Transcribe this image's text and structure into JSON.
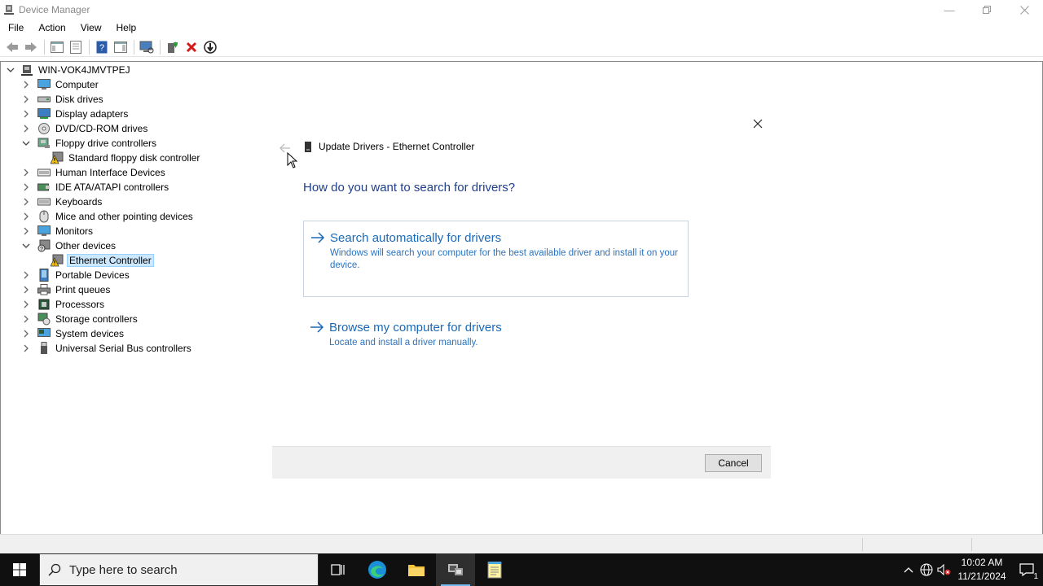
{
  "window": {
    "title": "Device Manager"
  },
  "menu": {
    "file": "File",
    "action": "Action",
    "view": "View",
    "help": "Help"
  },
  "tree": {
    "root": "WIN-VOK4JMVTPEJ",
    "items": [
      {
        "label": "Computer",
        "icon": "computer-icon",
        "expanded": false
      },
      {
        "label": "Disk drives",
        "icon": "disk-drive-icon",
        "expanded": false
      },
      {
        "label": "Display adapters",
        "icon": "display-adapter-icon",
        "expanded": false
      },
      {
        "label": "DVD/CD-ROM drives",
        "icon": "dvd-drive-icon",
        "expanded": false
      },
      {
        "label": "Floppy drive controllers",
        "icon": "floppy-controller-icon",
        "expanded": true
      },
      {
        "label": "Standard floppy disk controller",
        "icon": "warning-device-icon",
        "child": true
      },
      {
        "label": "Human Interface Devices",
        "icon": "hid-icon",
        "expanded": false
      },
      {
        "label": "IDE ATA/ATAPI controllers",
        "icon": "ide-controller-icon",
        "expanded": false
      },
      {
        "label": "Keyboards",
        "icon": "keyboard-icon",
        "expanded": false
      },
      {
        "label": "Mice and other pointing devices",
        "icon": "mouse-icon",
        "expanded": false
      },
      {
        "label": "Monitors",
        "icon": "monitor-icon",
        "expanded": false
      },
      {
        "label": "Other devices",
        "icon": "other-devices-icon",
        "expanded": true
      },
      {
        "label": "Ethernet Controller",
        "icon": "warning-device-icon",
        "child": true,
        "selected": true
      },
      {
        "label": "Portable Devices",
        "icon": "portable-device-icon",
        "expanded": false
      },
      {
        "label": "Print queues",
        "icon": "printer-icon",
        "expanded": false
      },
      {
        "label": "Processors",
        "icon": "processor-icon",
        "expanded": false
      },
      {
        "label": "Storage controllers",
        "icon": "storage-controller-icon",
        "expanded": false
      },
      {
        "label": "System devices",
        "icon": "system-devices-icon",
        "expanded": false
      },
      {
        "label": "Universal Serial Bus controllers",
        "icon": "usb-icon",
        "expanded": false
      }
    ]
  },
  "dialog": {
    "title": "Update Drivers - Ethernet Controller",
    "heading": "How do you want to search for drivers?",
    "option_auto": {
      "title": "Search automatically for drivers",
      "desc": "Windows will search your computer for the best available driver and install it on your device."
    },
    "option_browse": {
      "title": "Browse my computer for drivers",
      "desc": "Locate and install a driver manually."
    },
    "cancel": "Cancel"
  },
  "taskbar": {
    "search_placeholder": "Type here to search",
    "time": "10:02 AM",
    "date": "11/21/2024",
    "notification_count": "1"
  },
  "colors": {
    "accent": "#1a69b8",
    "selection": "#cce8ff",
    "taskbar": "#101010"
  }
}
